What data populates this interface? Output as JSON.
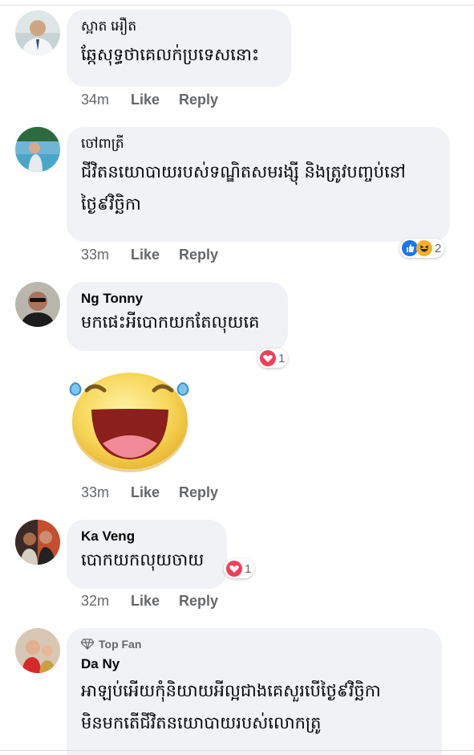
{
  "comments": [
    {
      "name": "ស្អាត អឿត",
      "text": "ឆ្កែសុទ្ធថាគេលក់ប្រទេសនោះ",
      "time": "34m",
      "like": "Like",
      "reply": "Reply"
    },
    {
      "name": "ចៅពាត្រី",
      "text": "ជីវិតនយោបាយរបស់ទណ្ឌិតសមរង្ស៊ី និងត្រូវបញ្ចប់នៅថ្ងៃ៩វិច្ឆិកា",
      "time": "33m",
      "like": "Like",
      "reply": "Reply",
      "reaction_count": "2",
      "reactions": [
        "like-icon",
        "haha-icon"
      ]
    },
    {
      "name": "Ng Tonny",
      "text": "មកផេះអីបោកយកតែលុយគេ",
      "time": "33m",
      "like": "Like",
      "reply": "Reply",
      "reaction_count": "1",
      "reactions": [
        "love-icon"
      ],
      "sticker": "laughing-face-sticker"
    },
    {
      "name": "Ka Veng",
      "text": "បោកយកលុយចាយ",
      "time": "32m",
      "like": "Like",
      "reply": "Reply",
      "reaction_count": "1",
      "reactions": [
        "love-icon"
      ]
    },
    {
      "name": "Da Ny",
      "badge": "Top Fan",
      "text": "អាឡប់អើយកុំនិយាយអីល្អជាងគេសួរបើថ្ងៃ៩វិច្ឆិកាមិនមកតើជីវិតនយោបាយរបស់លោកត្រូ"
    }
  ],
  "colors": {
    "bubble": "#f0f2f5",
    "meta": "#65676b",
    "like_blue": "#1877f2",
    "love_red": "#f33e58",
    "haha_yellow": "#f7b125"
  }
}
